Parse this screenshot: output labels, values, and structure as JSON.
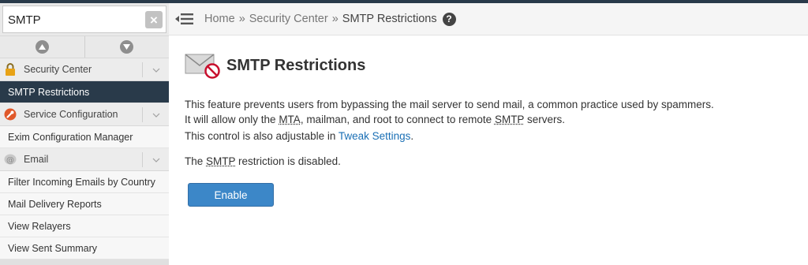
{
  "search": {
    "value": "SMTP"
  },
  "sidebar": {
    "groups": [
      {
        "label": "Security Center",
        "items": [
          {
            "label": "SMTP Restrictions"
          }
        ]
      },
      {
        "label": "Service Configuration",
        "items": [
          {
            "label": "Exim Configuration Manager"
          }
        ]
      },
      {
        "label": "Email",
        "items": [
          {
            "label": "Filter Incoming Emails by Country"
          },
          {
            "label": "Mail Delivery Reports"
          },
          {
            "label": "View Relayers"
          },
          {
            "label": "View Sent Summary"
          }
        ]
      }
    ]
  },
  "breadcrumb": {
    "home": "Home",
    "section": "Security Center",
    "current": "SMTP Restrictions",
    "separator": "»"
  },
  "page": {
    "title": "SMTP Restrictions",
    "desc_line1": "This feature prevents users from bypassing the mail server to send mail, a common practice used by spammers.",
    "desc_line2_a": "It will allow only the ",
    "desc_mta": "MTA",
    "desc_line2_b": ", mailman, and root to connect to remote ",
    "desc_smtp": "SMTP",
    "desc_line2_c": " servers.",
    "tweak_prefix": "This control is also adjustable in ",
    "tweak_link": "Tweak Settings",
    "tweak_suffix": ".",
    "status_a": "The ",
    "status_smtp": "SMTP",
    "status_b": " restriction is disabled.",
    "enable_label": "Enable"
  },
  "colors": {
    "nav_dark": "#293a4a",
    "link": "#1a6fb5",
    "button": "#3c87c8"
  }
}
